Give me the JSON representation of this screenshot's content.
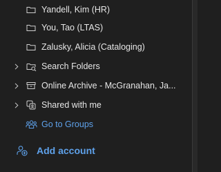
{
  "folders": [
    {
      "label": "Yandell, Kim (HR)",
      "icon": "folder-icon",
      "expandable": false
    },
    {
      "label": "You, Tao (LTAS)",
      "icon": "folder-icon",
      "expandable": false
    },
    {
      "label": "Zalusky, Alicia (Cataloging)",
      "icon": "folder-icon",
      "expandable": false
    },
    {
      "label": "Search Folders",
      "icon": "search-folder-icon",
      "expandable": true
    },
    {
      "label": "Online Archive - McGranahan, Ja...",
      "icon": "archive-icon",
      "expandable": true
    },
    {
      "label": "Shared with me",
      "icon": "shared-icon",
      "expandable": true
    }
  ],
  "go_to_groups": {
    "label": "Go to Groups",
    "icon": "groups-icon"
  },
  "add_account": {
    "label": "Add account",
    "icon": "add-person-icon"
  },
  "colors": {
    "background": "#1f1f1f",
    "text": "#e6e6e6",
    "link": "#5ea1ea",
    "icon": "#cfcfcf"
  }
}
